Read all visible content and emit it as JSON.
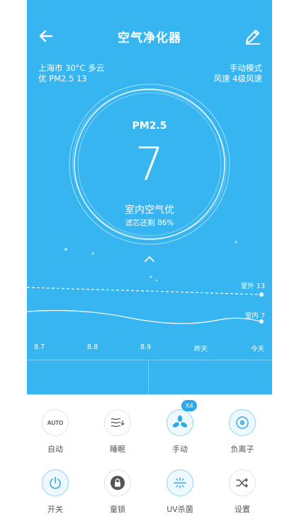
{
  "header": {
    "title": "空气净化器",
    "back_icon": "arrow-left-icon",
    "edit_icon": "pencil-icon"
  },
  "weather": {
    "line1": "上海市 30°C 多云",
    "line2": "优 PM2.5 13"
  },
  "mode": {
    "line1": "手动模式",
    "line2": "风速 4级风速"
  },
  "gauge": {
    "label": "PM2.5",
    "value": "7",
    "quality": "室内空气优",
    "filter": "滤芯还剩 86%"
  },
  "chart_data": {
    "type": "line",
    "categories": [
      "8.7",
      "8.8",
      "8.9",
      "昨天",
      "今天"
    ],
    "series": [
      {
        "name": "室外",
        "values": [
          13,
          13,
          13,
          13,
          13
        ]
      },
      {
        "name": "室内",
        "values": [
          7,
          7,
          7,
          7,
          7
        ]
      }
    ],
    "labels": {
      "outdoor": "室外 13",
      "indoor": "室内 7"
    }
  },
  "controls": [
    {
      "label": "自动",
      "icon": "auto-icon",
      "icon_text": "AUTO",
      "active": false
    },
    {
      "label": "睡眠",
      "icon": "sleep-icon",
      "active": false
    },
    {
      "label": "手动",
      "icon": "fan-icon",
      "active": true,
      "badge": "X4"
    },
    {
      "label": "负离子",
      "icon": "anion-icon",
      "active": true
    },
    {
      "label": "开关",
      "icon": "power-icon",
      "active": true
    },
    {
      "label": "童锁",
      "icon": "lock-icon",
      "active": false
    },
    {
      "label": "UV杀菌",
      "icon": "uv-icon",
      "active": true
    },
    {
      "label": "设置",
      "icon": "shuffle-icon",
      "active": false
    }
  ],
  "colors": {
    "primary": "#36b5f0",
    "icon_blue": "#2fa8e8",
    "icon_gray": "#555555"
  }
}
